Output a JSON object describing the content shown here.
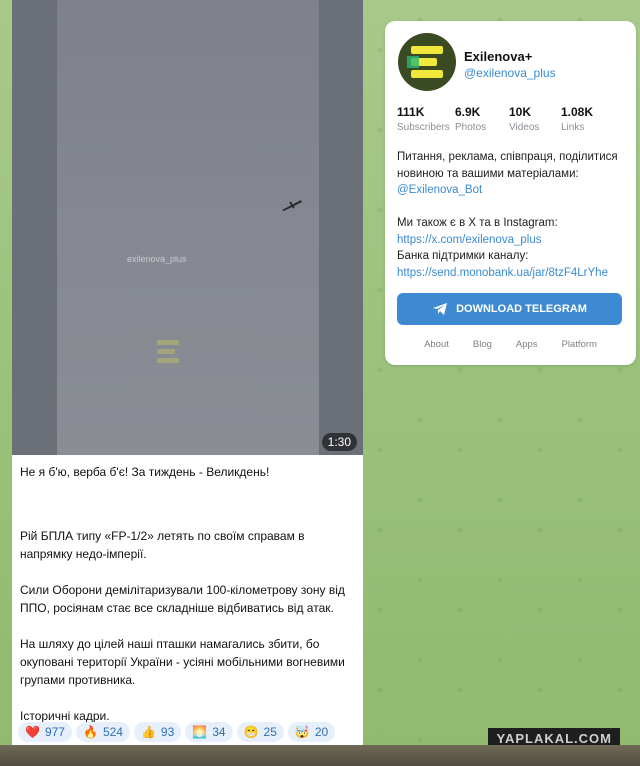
{
  "video": {
    "watermark": "exilenova_plus",
    "duration": "1:30"
  },
  "post": {
    "paragraphs": [
      "Не я б'ю, верба б'є! За тиждень - Великдень!",
      "Рій БПЛА типу «FP-1/2» летять по своїм справам в напрямку недо-імперії.",
      "Сили Оборони демілітаризували 100-кілометрову зону від ППО, росіянам стає все складніше відбиватись від атак.",
      "На шляху до цілей наші пташки намагались збити, бо окуповані території України - усіяні мобільними вогневими групами противника.",
      "Історичні кадри."
    ],
    "reactions": [
      {
        "emoji": "❤️",
        "count": "977"
      },
      {
        "emoji": "🔥",
        "count": "524"
      },
      {
        "emoji": "👍",
        "count": "93"
      },
      {
        "emoji": "🌅",
        "count": "34"
      },
      {
        "emoji": "😁",
        "count": "25"
      },
      {
        "emoji": "🤯",
        "count": "20"
      }
    ]
  },
  "channel": {
    "name": "Exilenova+",
    "handle": "@exilenova_plus",
    "stats": [
      {
        "value": "111K",
        "label": "Subscribers"
      },
      {
        "value": "6.9K",
        "label": "Photos"
      },
      {
        "value": "10K",
        "label": "Videos"
      },
      {
        "value": "1.08K",
        "label": "Links"
      }
    ],
    "desc_line1": "Питання, реклама, співпраця, поділитися новиною та вашими матеріалами:",
    "bot_link": "@Exilenova_Bot",
    "desc_line2": "Ми також є в Х та в Instagram:",
    "x_link": "https://x.com/exilenova_plus",
    "desc_line3": "Банка підтримки каналу:",
    "mono_link": "https://send.monobank.ua/jar/8tzF4LrYhe",
    "download_label": "DOWNLOAD TELEGRAM",
    "footer": [
      "About",
      "Blog",
      "Apps",
      "Platform"
    ]
  },
  "watermark_site": "YAPLAKAL.COM",
  "colors": {
    "accent": "#3d8ad2",
    "link": "#3a8bd0",
    "reaction_bg": "#e7f0fa"
  }
}
